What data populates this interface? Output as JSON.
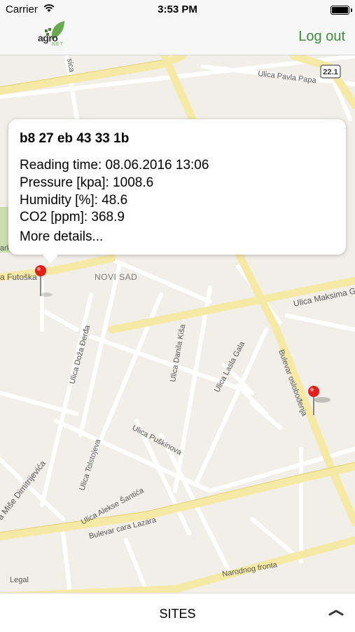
{
  "status": {
    "carrier": "Carrier",
    "time": "3:53 PM"
  },
  "nav": {
    "logo_text": "agro",
    "logo_sub": "NET",
    "logout_label": "Log out"
  },
  "popup": {
    "title": "b8 27 eb 43 33 1b",
    "reading_time": "Reading time: 08.06.2016 13:06",
    "pressure": "Pressure [kpa]: 1008.6",
    "humidity": "Humidity [%]: 48.6",
    "co2": "CO2 [ppm]: 368.9",
    "more": "More details..."
  },
  "map": {
    "labels": {
      "pavla_papa": "Ulica Pavla Papa",
      "route": "22.1",
      "futoska": "a Futoška",
      "novi_sad": "NOVI SAD",
      "maksima": "Ulica Maksima G",
      "doza_derda": "Ulica Doža Đerđa",
      "danila_kisa": "Ulica Danila Kiša",
      "lasla_gala": "Ulica Lasla Gala",
      "oslobodjenja": "Bulevar oslobođenja",
      "puskinova": "Ulica Puškinova",
      "tolstojeva": "Ulica Tolstojeva",
      "mise": "a Miše Dimitrijevića",
      "aleksa": "Ulica Alekse Šantića",
      "cara_lazara": "Bulevar cara Lazara",
      "narodnog_fronta": "Narodnog fronta",
      "park": "ark",
      "sica": "sica"
    },
    "legal": "Legal"
  },
  "bottom": {
    "sites_label": "SITES"
  }
}
